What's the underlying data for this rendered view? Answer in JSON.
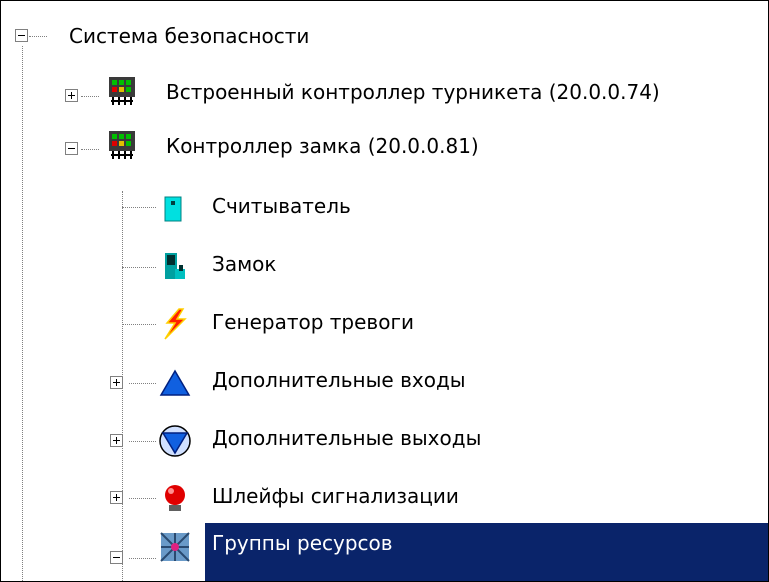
{
  "tree": {
    "root": {
      "label": "Система безопасности",
      "expanded": true
    },
    "nodes": [
      {
        "label": "Встроенный контроллер турникета (20.0.0.74)",
        "icon": "controller-icon",
        "expanded": false
      },
      {
        "label": "Контроллер замка (20.0.0.81)",
        "icon": "controller-icon",
        "expanded": true
      },
      {
        "label": "Считыватель",
        "icon": "reader-icon"
      },
      {
        "label": "Замок",
        "icon": "lock-icon"
      },
      {
        "label": "Генератор тревоги",
        "icon": "alarm-generator-icon"
      },
      {
        "label": "Дополнительные входы",
        "icon": "input-triangle-icon",
        "expanded": false
      },
      {
        "label": "Дополнительные выходы",
        "icon": "output-triangle-icon",
        "expanded": false
      },
      {
        "label": "Шлейфы сигнализации",
        "icon": "alarm-lamp-icon",
        "expanded": false
      },
      {
        "label": "Группы ресурсов",
        "icon": "resource-group-icon",
        "expanded": true,
        "selected": true
      }
    ]
  },
  "colors": {
    "selection": "#0a246a",
    "selection_text": "#ffffff",
    "connector": "#808080"
  }
}
